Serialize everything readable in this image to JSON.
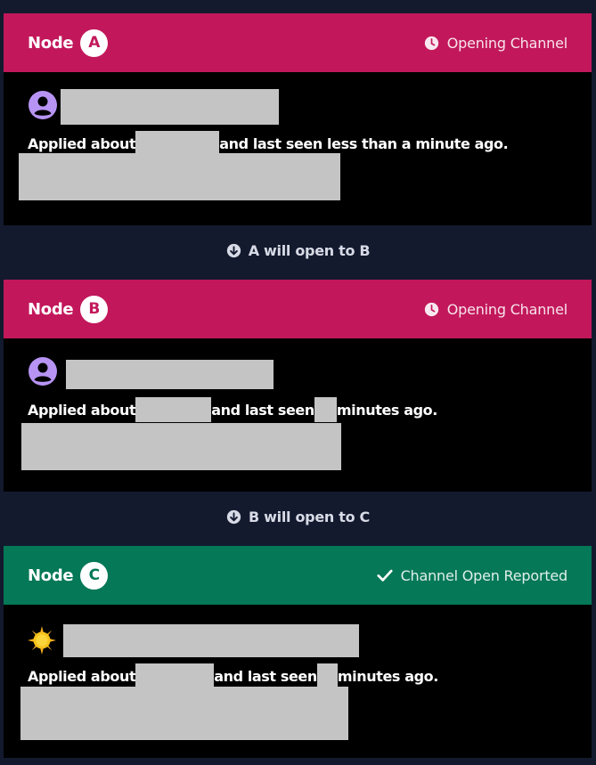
{
  "colors": {
    "opening_header": "#c2185b",
    "open_header": "#047857",
    "page_background": "#131a2e",
    "avatar_purple": "#b794f4",
    "redaction": "#c4c4c4"
  },
  "nodes": [
    {
      "label": "Node",
      "letter": "A",
      "status": "Opening Channel",
      "status_icon": "clock-icon",
      "avatar_icon": "user-circle-icon",
      "applied_prefix": "Applied about",
      "applied_middle": "and last seen less than a minute ago.",
      "applied_suffix": ""
    },
    {
      "label": "Node",
      "letter": "B",
      "status": "Opening Channel",
      "status_icon": "clock-icon",
      "avatar_icon": "user-circle-icon",
      "applied_prefix": "Applied about",
      "applied_middle": "and last seen",
      "applied_suffix": "minutes ago."
    },
    {
      "label": "Node",
      "letter": "C",
      "status": "Channel Open Reported",
      "status_icon": "check-icon",
      "avatar_icon": "sun-icon",
      "applied_prefix": "Applied about",
      "applied_middle": "and last seen",
      "applied_suffix": "minutes ago."
    }
  ],
  "connectors": [
    {
      "text": "A will open to B",
      "icon": "arrow-down-circle-icon"
    },
    {
      "text": "B will open to C",
      "icon": "arrow-down-circle-icon"
    }
  ]
}
